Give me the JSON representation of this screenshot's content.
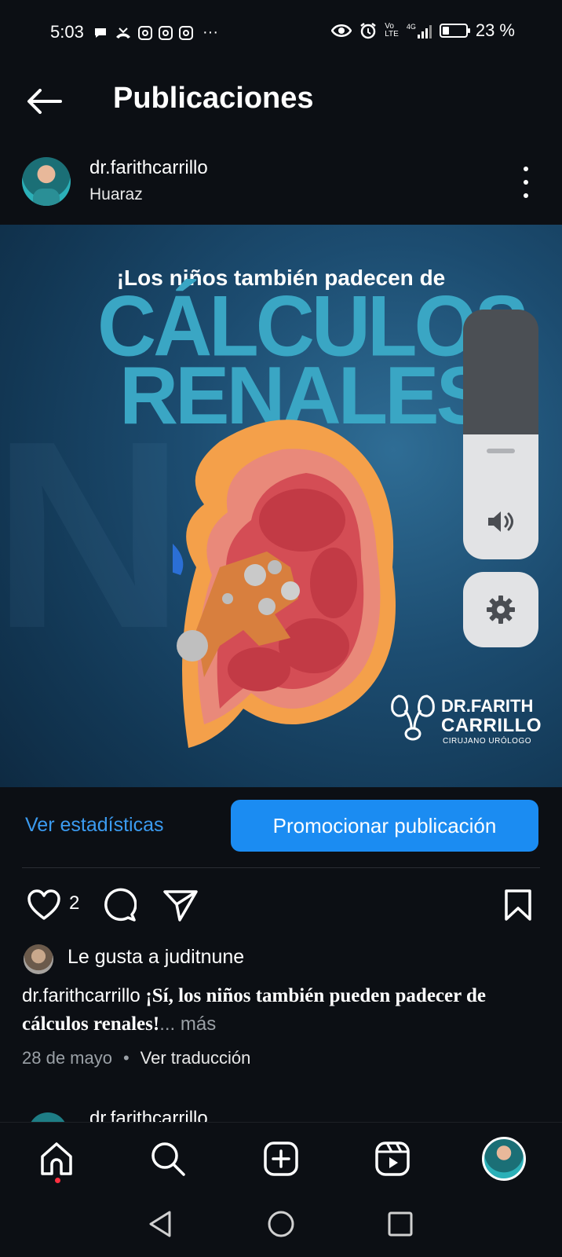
{
  "status_bar": {
    "time": "5:03",
    "battery": "23 %",
    "network_top": "Vo",
    "network_bottom": "LTE",
    "signal_label": "4G"
  },
  "header": {
    "title": "Publicaciones"
  },
  "post": {
    "username": "dr.farithcarrillo",
    "location": "Huaraz",
    "image": {
      "headline_small": "¡Los niños también padecen de",
      "headline_big_1": "CÁLCULOS",
      "headline_big_2": "RENALES!",
      "brand_name_1": "DR.FARITH",
      "brand_name_2": "CARRILLO",
      "brand_subtitle": "CIRUJANO URÓLOGO"
    },
    "stats_link": "Ver estadísticas",
    "promote_button": "Promocionar publicación",
    "likes_count": "2",
    "liked_by_text": "Le gusta a juditnune",
    "caption_username": "dr.farithcarrillo",
    "caption_text": "¡Sí, los niños también pueden padecer de cálculos renales!",
    "caption_more": "... más",
    "date": "28 de mayo",
    "separator": "•",
    "translate": "Ver traducción"
  },
  "next_post": {
    "username": "dr.farithcarrillo"
  },
  "volume": {
    "level": 0.5
  },
  "colors": {
    "accent_blue": "#1b8cf2",
    "link_blue": "#3b9bf0",
    "headline_teal": "#3aa6c4",
    "background": "#0c0f14"
  },
  "icons": {
    "back": "arrow-left-icon",
    "more": "more-vertical-icon",
    "like": "heart-icon",
    "comment": "comment-icon",
    "share": "send-icon",
    "save": "bookmark-icon",
    "volume": "speaker-icon",
    "settings": "gear-icon",
    "home": "home-icon",
    "search": "search-icon",
    "create": "plus-square-icon",
    "reels": "reels-icon",
    "sys_back": "triangle-back-icon",
    "sys_home": "circle-home-icon",
    "sys_recent": "square-recent-icon"
  }
}
